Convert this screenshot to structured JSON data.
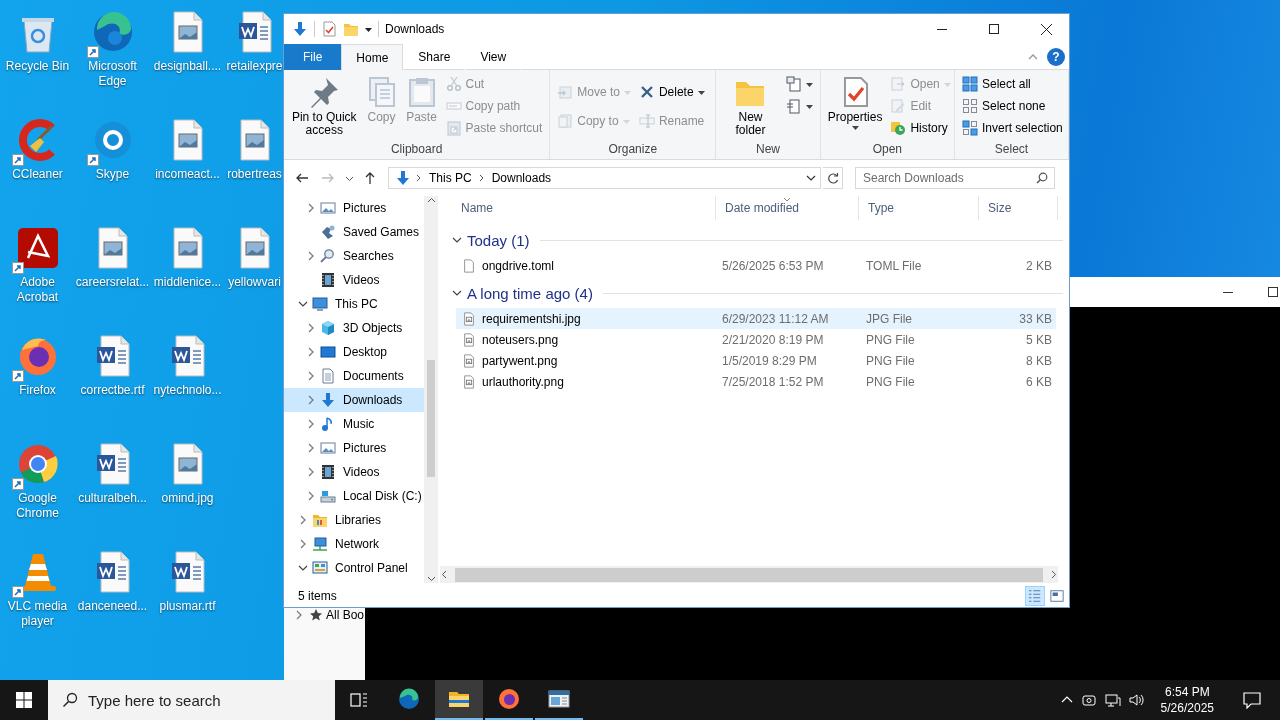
{
  "desktop": {
    "icons": [
      {
        "label": "Recycle Bin",
        "kind": "recycle",
        "shortcut": false
      },
      {
        "label": "CCleaner",
        "kind": "ccleaner",
        "shortcut": true
      },
      {
        "label": "Adobe Acrobat",
        "kind": "acrobat",
        "shortcut": true
      },
      {
        "label": "Firefox",
        "kind": "firefox",
        "shortcut": true
      },
      {
        "label": "Google Chrome",
        "kind": "chrome",
        "shortcut": true
      },
      {
        "label": "VLC media player",
        "kind": "vlc",
        "shortcut": true
      },
      {
        "label": "Microsoft Edge",
        "kind": "edge",
        "shortcut": true
      },
      {
        "label": "Skype",
        "kind": "skype",
        "shortcut": true
      },
      {
        "label": "careersrelat...",
        "kind": "image",
        "shortcut": false
      },
      {
        "label": "correctbe.rtf",
        "kind": "word",
        "shortcut": false
      },
      {
        "label": "culturalbeh...",
        "kind": "word",
        "shortcut": false
      },
      {
        "label": "danceneed...",
        "kind": "word",
        "shortcut": false
      },
      {
        "label": "designball....",
        "kind": "image",
        "shortcut": false
      },
      {
        "label": "incomeact...",
        "kind": "image",
        "shortcut": false
      },
      {
        "label": "middlenice...",
        "kind": "image",
        "shortcut": false
      },
      {
        "label": "nytechnolo...",
        "kind": "word",
        "shortcut": false
      },
      {
        "label": "omind.jpg",
        "kind": "image",
        "shortcut": false
      },
      {
        "label": "plusmar.rtf",
        "kind": "word",
        "shortcut": false
      },
      {
        "label": "retailexpre",
        "kind": "word",
        "shortcut": false
      },
      {
        "label": "robertreas",
        "kind": "image",
        "shortcut": false
      },
      {
        "label": "yellowvari",
        "kind": "image",
        "shortcut": false
      }
    ]
  },
  "background_window": {
    "sidebar_item": "All Boo"
  },
  "explorer": {
    "title": "Downloads",
    "ribbon": {
      "tabs": [
        {
          "label": "File",
          "kind": "file",
          "selected": false
        },
        {
          "label": "Home",
          "kind": "tab",
          "selected": true
        },
        {
          "label": "Share",
          "kind": "tab",
          "selected": false
        },
        {
          "label": "View",
          "kind": "tab",
          "selected": false
        }
      ],
      "help": "?",
      "groups": [
        {
          "label": "Clipboard",
          "columns": [
            [
              {
                "label": "Pin to Quick access",
                "kind": "pin",
                "disabled": false,
                "dropdown": false
              }
            ],
            [
              {
                "label": "Copy",
                "kind": "copy",
                "disabled": true,
                "dropdown": false
              }
            ],
            [
              {
                "label": "Paste",
                "kind": "paste",
                "disabled": true,
                "dropdown": false
              }
            ],
            [
              {
                "label": "Cut",
                "kind": "cut",
                "disabled": true,
                "dropdown": false
              },
              {
                "label": "Copy path",
                "kind": "copy-path",
                "disabled": true,
                "dropdown": false
              },
              {
                "label": "Paste shortcut",
                "kind": "paste-shortcut",
                "disabled": true,
                "dropdown": false
              }
            ]
          ]
        },
        {
          "label": "Organize",
          "columns": [
            [
              {
                "label": "Move to",
                "kind": "move",
                "disabled": true,
                "dropdown": true
              },
              {
                "label": "Copy to",
                "kind": "copy-to",
                "disabled": true,
                "dropdown": true
              }
            ],
            [
              {
                "label": "Delete",
                "kind": "delete",
                "disabled": false,
                "dropdown": true
              },
              {
                "label": "Rename",
                "kind": "rename",
                "disabled": true,
                "dropdown": false
              }
            ]
          ]
        },
        {
          "label": "New",
          "columns": [
            [
              {
                "label": "New folder",
                "kind": "new-folder",
                "disabled": false,
                "dropdown": false
              }
            ],
            [
              {
                "kind": "new-item",
                "disabled": false,
                "dropdown": true
              },
              {
                "kind": "easy-access",
                "disabled": false,
                "dropdown": true
              }
            ]
          ]
        },
        {
          "label": "Open",
          "columns": [
            [
              {
                "label": "Properties",
                "kind": "properties",
                "disabled": false,
                "dropdown": true
              }
            ],
            [
              {
                "label": "Open",
                "kind": "open",
                "disabled": true,
                "dropdown": true
              },
              {
                "label": "Edit",
                "kind": "edit",
                "disabled": true,
                "dropdown": false
              },
              {
                "label": "History",
                "kind": "history",
                "disabled": false,
                "dropdown": false
              }
            ]
          ]
        },
        {
          "label": "Select",
          "columns": [
            [
              {
                "label": "Select all",
                "kind": "select-all",
                "disabled": false,
                "dropdown": false
              },
              {
                "label": "Select none",
                "kind": "select-none",
                "disabled": false,
                "dropdown": false
              },
              {
                "label": "Invert selection",
                "kind": "invert",
                "disabled": false,
                "dropdown": false
              }
            ]
          ]
        }
      ]
    },
    "address": {
      "path": [
        "This PC",
        "Downloads"
      ],
      "search_placeholder": "Search Downloads"
    },
    "navigation": {
      "scrolled_branch": [
        {
          "label": "Pictures",
          "kind": "pictures",
          "expandable": true,
          "expanded": false,
          "selected": false
        },
        {
          "label": "Saved Games",
          "kind": "games",
          "expandable": false,
          "selected": false
        },
        {
          "label": "Searches",
          "kind": "search",
          "expandable": true,
          "expanded": false,
          "selected": false
        },
        {
          "label": "Videos",
          "kind": "videos",
          "expandable": false,
          "selected": false
        }
      ],
      "items": [
        {
          "label": "This PC",
          "kind": "pc",
          "expandable": true,
          "expanded": true,
          "selected": false,
          "children": [
            {
              "label": "3D Objects",
              "kind": "objects",
              "expandable": true,
              "expanded": false,
              "selected": false
            },
            {
              "label": "Desktop",
              "kind": "desktop",
              "expandable": true,
              "expanded": false,
              "selected": false
            },
            {
              "label": "Documents",
              "kind": "documents",
              "expandable": true,
              "expanded": false,
              "selected": false
            },
            {
              "label": "Downloads",
              "kind": "downloads",
              "expandable": true,
              "expanded": false,
              "selected": true
            },
            {
              "label": "Music",
              "kind": "music",
              "expandable": true,
              "expanded": false,
              "selected": false
            },
            {
              "label": "Pictures",
              "kind": "pictures",
              "expandable": true,
              "expanded": false,
              "selected": false
            },
            {
              "label": "Videos",
              "kind": "videos",
              "expandable": true,
              "expanded": false,
              "selected": false
            },
            {
              "label": "Local Disk (C:)",
              "kind": "disk",
              "expandable": true,
              "expanded": false,
              "selected": false
            }
          ]
        },
        {
          "label": "Libraries",
          "kind": "libraries",
          "expandable": true,
          "expanded": false,
          "selected": false
        },
        {
          "label": "Network",
          "kind": "network",
          "expandable": true,
          "expanded": false,
          "selected": false
        },
        {
          "label": "Control Panel",
          "kind": "control",
          "expandable": true,
          "expanded": true,
          "selected": false
        }
      ]
    },
    "columns": [
      {
        "label": "Name",
        "sorted": false
      },
      {
        "label": "Date modified",
        "sorted": true
      },
      {
        "label": "Type",
        "sorted": false
      },
      {
        "label": "Size",
        "sorted": false
      }
    ],
    "groups": [
      {
        "title": "Today (1)",
        "expanded": true,
        "files": [
          {
            "name": "ongdrive.toml",
            "date": "5/26/2025 6:53 PM",
            "type": "TOML File",
            "size": "2 KB",
            "kind": "blank",
            "selected": false
          }
        ]
      },
      {
        "title": "A long time ago (4)",
        "expanded": true,
        "files": [
          {
            "name": "requirementshi.jpg",
            "date": "6/29/2023 11:12 AM",
            "type": "JPG File",
            "size": "33 KB",
            "kind": "image",
            "selected": true
          },
          {
            "name": "noteusers.png",
            "date": "2/21/2020 8:19 PM",
            "type": "PNG File",
            "size": "5 KB",
            "kind": "image",
            "selected": false
          },
          {
            "name": "partywent.png",
            "date": "1/5/2019 8:29 PM",
            "type": "PNG File",
            "size": "8 KB",
            "kind": "image",
            "selected": false
          },
          {
            "name": "urlauthority.png",
            "date": "7/25/2018 1:52 PM",
            "type": "PNG File",
            "size": "6 KB",
            "kind": "image",
            "selected": false
          }
        ]
      }
    ],
    "status": "5 items",
    "views": [
      {
        "kind": "details",
        "selected": true
      },
      {
        "kind": "tiles",
        "selected": false
      }
    ]
  },
  "taskbar": {
    "search_placeholder": "Type here to search",
    "apps": [
      {
        "kind": "edge",
        "running": false,
        "active": false
      },
      {
        "kind": "explorer",
        "running": true,
        "active": true
      },
      {
        "kind": "firefox",
        "running": true,
        "active": false
      },
      {
        "kind": "window",
        "running": true,
        "active": false
      }
    ],
    "time": "6:54 PM",
    "date": "5/26/2025"
  }
}
